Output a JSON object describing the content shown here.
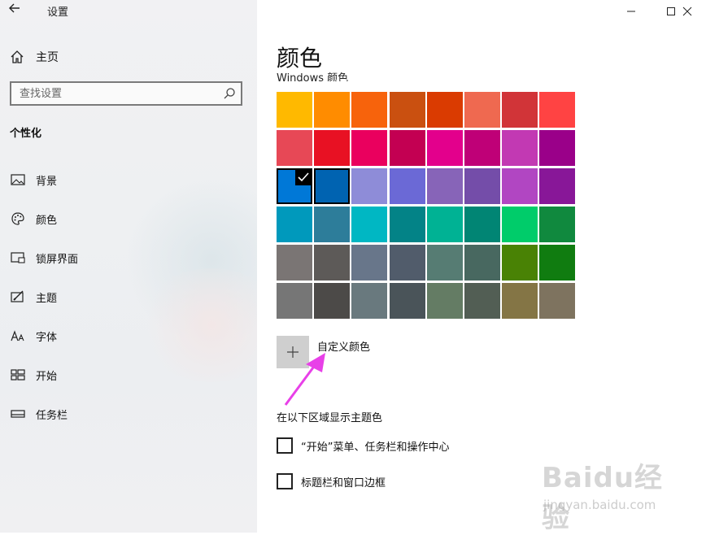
{
  "window": {
    "title": "设置",
    "minimize_icon": "minimize-icon",
    "maximize_icon": "maximize-icon",
    "close_icon": "close-icon"
  },
  "sidebar": {
    "home_label": "主页",
    "search_placeholder": "查找设置",
    "section": "个性化",
    "items": [
      {
        "label": "背景",
        "icon": "image-icon"
      },
      {
        "label": "颜色",
        "icon": "palette-icon"
      },
      {
        "label": "锁屏界面",
        "icon": "lockscreen-icon"
      },
      {
        "label": "主题",
        "icon": "theme-icon"
      },
      {
        "label": "字体",
        "icon": "font-icon"
      },
      {
        "label": "开始",
        "icon": "start-icon"
      },
      {
        "label": "任务栏",
        "icon": "taskbar-icon"
      }
    ]
  },
  "main": {
    "title": "颜色",
    "palette_label": "Windows 颜色",
    "selected_index": 16,
    "swatches": [
      "#FFB900",
      "#FF8C00",
      "#F7630C",
      "#CA5010",
      "#DA3B01",
      "#EF6950",
      "#D13438",
      "#FF4343",
      "#E74856",
      "#E81123",
      "#EA005E",
      "#C30052",
      "#E3008C",
      "#BF0077",
      "#C239B3",
      "#9A0089",
      "#0078D7",
      "#0063B1",
      "#8E8CD8",
      "#6B69D6",
      "#8764B8",
      "#744DA9",
      "#B146C2",
      "#881798",
      "#0099BC",
      "#2D7D9A",
      "#00B7C3",
      "#038387",
      "#00B294",
      "#018574",
      "#00CC6A",
      "#10893E",
      "#7A7574",
      "#5D5A58",
      "#68768A",
      "#515C6B",
      "#567C73",
      "#486860",
      "#498205",
      "#107C10",
      "#767676",
      "#4C4A48",
      "#69797E",
      "#4A5459",
      "#647C64",
      "#525E54",
      "#847545",
      "#7E735F"
    ],
    "custom_color_label": "自定义颜色",
    "show_accent_heading": "在以下区域显示主题色",
    "checkboxes": [
      {
        "label": "“开始”菜单、任务栏和操作中心",
        "checked": false
      },
      {
        "label": "标题栏和窗口边框",
        "checked": false
      }
    ]
  },
  "watermark": {
    "brand": "Baidu经验",
    "url": "jingyan.baidu.com"
  }
}
